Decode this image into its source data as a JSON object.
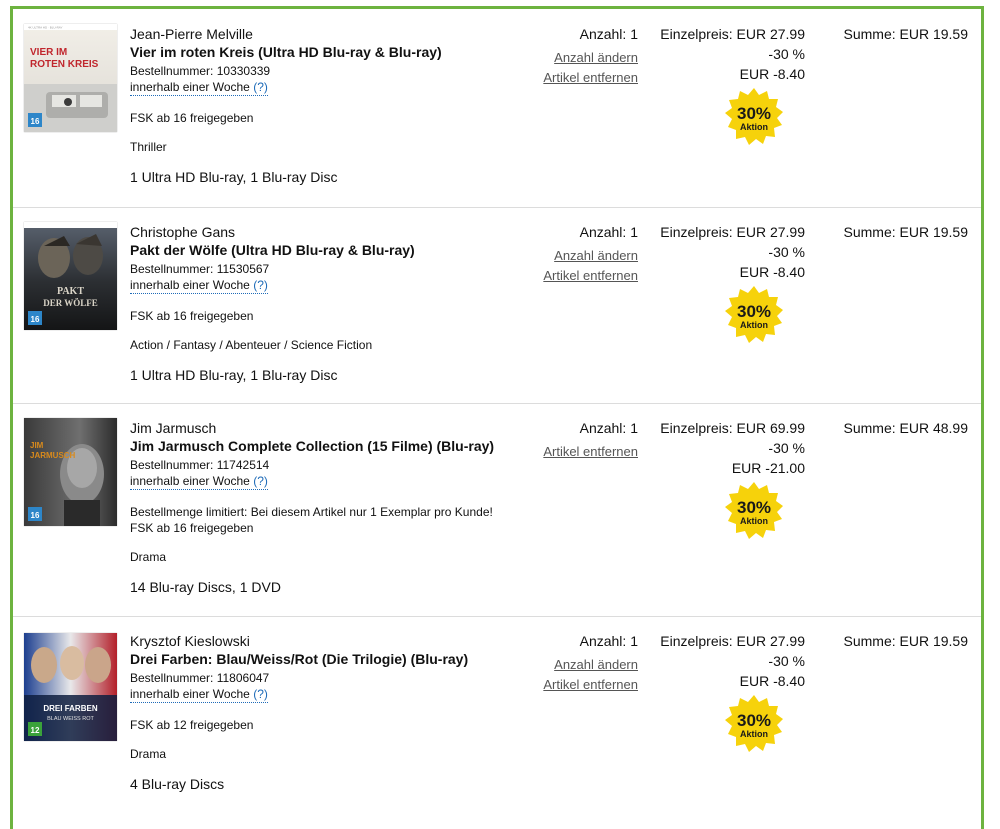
{
  "labels": {
    "quantity_prefix": "Anzahl:",
    "change_quantity": "Anzahl ändern",
    "remove_item": "Artikel entfernen",
    "unit_price_prefix": "Einzelpreis:",
    "sum_prefix": "Summe:",
    "order_number_prefix": "Bestellnummer:",
    "help_mark": "(?)"
  },
  "colors": {
    "frame_border": "#6db33f",
    "link_blue": "#1e6bb8",
    "badge_yellow": "#f6d20b"
  },
  "items": [
    {
      "author": "Jean-Pierre Melville",
      "title": "Vier im roten Kreis (Ultra HD Blu-ray & Blu-ray)",
      "order_number": "10330339",
      "delivery": "innerhalb einer Woche",
      "limit_note": "",
      "fsk": "FSK ab 16 freigegeben",
      "genre": "Thriller",
      "format": "1 Ultra HD Blu-ray, 1 Blu-ray Disc",
      "quantity": "1",
      "has_change_link": true,
      "unit_price": "EUR 27.99",
      "discount_percent": "-30 %",
      "discount_amount": "EUR -8.40",
      "badge_percent": "30%",
      "badge_label": "Aktion",
      "sum": "EUR 19.59",
      "cover_title_lines": [
        "VIER IM",
        "ROTEN KREIS"
      ],
      "cover_rating": "16"
    },
    {
      "author": "Christophe Gans",
      "title": "Pakt der Wölfe (Ultra HD Blu-ray & Blu-ray)",
      "order_number": "11530567",
      "delivery": "innerhalb einer Woche",
      "limit_note": "",
      "fsk": "FSK ab 16 freigegeben",
      "genre": "Action / Fantasy / Abenteuer / Science Fiction",
      "format": "1 Ultra HD Blu-ray, 1 Blu-ray Disc",
      "quantity": "1",
      "has_change_link": true,
      "unit_price": "EUR 27.99",
      "discount_percent": "-30 %",
      "discount_amount": "EUR -8.40",
      "badge_percent": "30%",
      "badge_label": "Aktion",
      "sum": "EUR 19.59",
      "cover_title_lines": [
        "PAKT",
        "DER WÖLFE"
      ],
      "cover_rating": "16"
    },
    {
      "author": "Jim Jarmusch",
      "title": "Jim Jarmusch Complete Collection (15 Filme) (Blu-ray)",
      "order_number": "11742514",
      "delivery": "innerhalb einer Woche",
      "limit_note": "Bestellmenge limitiert: Bei diesem Artikel nur 1 Exemplar pro Kunde!",
      "fsk": "FSK ab 16 freigegeben",
      "genre": "Drama",
      "format": "14 Blu-ray Discs, 1 DVD",
      "quantity": "1",
      "has_change_link": false,
      "unit_price": "EUR 69.99",
      "discount_percent": "-30 %",
      "discount_amount": "EUR -21.00",
      "badge_percent": "30%",
      "badge_label": "Aktion",
      "sum": "EUR 48.99",
      "cover_title_lines": [
        "JIM",
        "JARMUSCH"
      ],
      "cover_rating": "16"
    },
    {
      "author": "Krysztof Kieslowski",
      "title": "Drei Farben: Blau/Weiss/Rot (Die Trilogie) (Blu-ray)",
      "order_number": "11806047",
      "delivery": "innerhalb einer Woche",
      "limit_note": "",
      "fsk": "FSK ab 12 freigegeben",
      "genre": "Drama",
      "format": "4 Blu-ray Discs",
      "quantity": "1",
      "has_change_link": true,
      "unit_price": "EUR 27.99",
      "discount_percent": "-30 %",
      "discount_amount": "EUR -8.40",
      "badge_percent": "30%",
      "badge_label": "Aktion",
      "sum": "EUR 19.59",
      "cover_title_lines": [
        "DREI FARBEN",
        "BLAU WEISS ROT"
      ],
      "cover_rating": "12"
    }
  ]
}
